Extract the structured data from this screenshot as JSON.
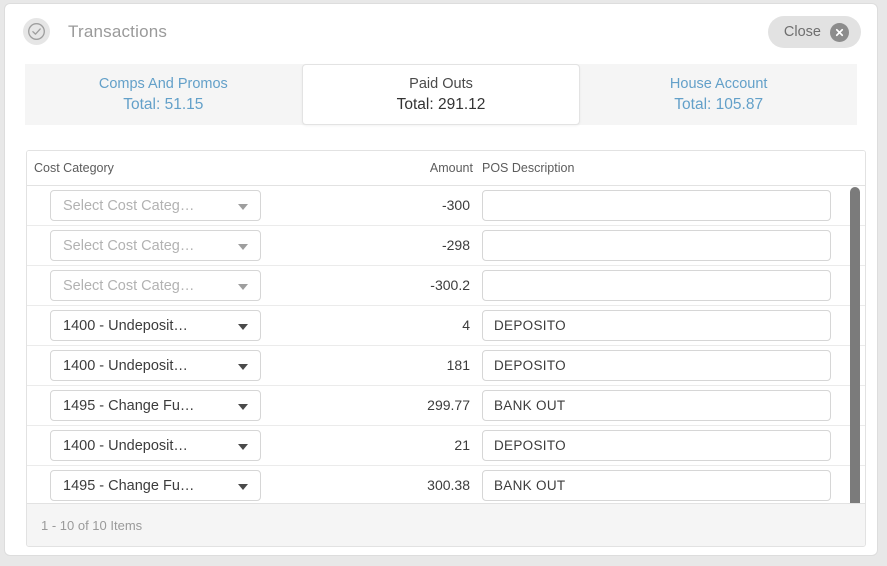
{
  "window": {
    "title": "Transactions",
    "status_icon": "check-circle-icon",
    "close_label": "Close",
    "close_icon": "close-circle-icon"
  },
  "tabs": [
    {
      "name": "Comps And Promos",
      "total": "Total: 51.15",
      "active": false
    },
    {
      "name": "Paid Outs",
      "total": "Total: 291.12",
      "active": true
    },
    {
      "name": "House Account",
      "total": "Total: 105.87",
      "active": false
    }
  ],
  "grid": {
    "columns": [
      {
        "key": "category",
        "label": "Cost Category"
      },
      {
        "key": "amount",
        "label": "Amount"
      },
      {
        "key": "pos",
        "label": "POS Description"
      }
    ],
    "category_placeholder": "Select Cost Categ…",
    "rows": [
      {
        "category": "",
        "amount": "-300",
        "pos": ""
      },
      {
        "category": "",
        "amount": "-298",
        "pos": ""
      },
      {
        "category": "",
        "amount": "-300.2",
        "pos": ""
      },
      {
        "category": "1400 - Undeposit…",
        "amount": "4",
        "pos": "DEPOSITO"
      },
      {
        "category": "1400 - Undeposit…",
        "amount": "181",
        "pos": "DEPOSITO"
      },
      {
        "category": "1495 - Change Fu…",
        "amount": "299.77",
        "pos": "BANK OUT"
      },
      {
        "category": "1400 - Undeposit…",
        "amount": "21",
        "pos": "DEPOSITO"
      },
      {
        "category": "1495 - Change Fu…",
        "amount": "300.38",
        "pos": "BANK OUT"
      },
      {
        "category": "",
        "amount": "",
        "pos": ""
      }
    ],
    "footer_text": "1 - 10 of 10 Items"
  },
  "colors": {
    "tab_link": "#63a0c9",
    "page_background": "#e8e8e8",
    "tabs_background": "#f5f5f5",
    "scrollbar_thumb": "#7b7b7b"
  }
}
